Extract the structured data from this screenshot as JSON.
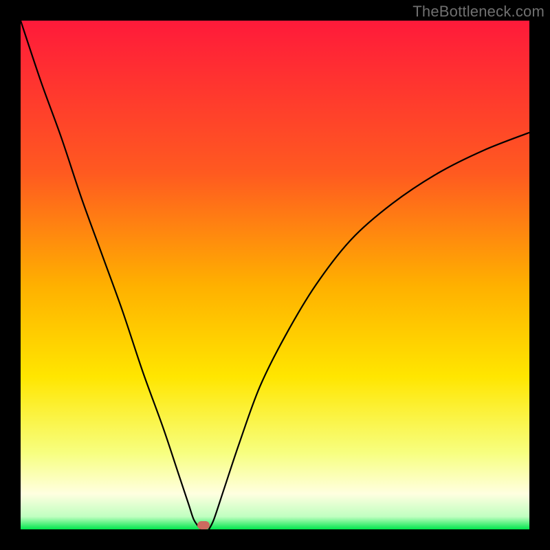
{
  "watermark": "TheBottleneck.com",
  "colors": {
    "top": "#ff1a3a",
    "upper_mid": "#ff8a00",
    "mid": "#ffe600",
    "lower_mid": "#f7ff66",
    "pale": "#ffffdd",
    "green": "#00e64d",
    "marker": "#cc6a5f",
    "curve": "#000000",
    "frame": "#000000"
  },
  "chart_data": {
    "type": "line",
    "title": "",
    "xlabel": "",
    "ylabel": "",
    "xlim": [
      0,
      100
    ],
    "ylim": [
      0,
      100
    ],
    "series": [
      {
        "name": "bottleneck-curve-left",
        "x": [
          0,
          4,
          8,
          12,
          16,
          20,
          24,
          28,
          31,
          33,
          34,
          35,
          35.5
        ],
        "y": [
          100,
          88,
          77,
          65,
          54,
          43,
          31,
          20,
          11,
          5,
          2,
          0.5,
          0
        ]
      },
      {
        "name": "bottleneck-curve-right",
        "x": [
          37,
          38,
          40,
          43,
          47,
          52,
          58,
          65,
          73,
          82,
          91,
          100
        ],
        "y": [
          0,
          2,
          8,
          17,
          28,
          38,
          48,
          57,
          64,
          70,
          74.5,
          78
        ]
      }
    ],
    "marker": {
      "x": 36,
      "y": 0.8
    },
    "gradient_bands": [
      {
        "pos": 0.0,
        "color": "#ff1a3a"
      },
      {
        "pos": 0.3,
        "color": "#ff5a20"
      },
      {
        "pos": 0.52,
        "color": "#ffb000"
      },
      {
        "pos": 0.7,
        "color": "#ffe600"
      },
      {
        "pos": 0.85,
        "color": "#f7ff80"
      },
      {
        "pos": 0.93,
        "color": "#ffffe0"
      },
      {
        "pos": 0.975,
        "color": "#c0ffc0"
      },
      {
        "pos": 1.0,
        "color": "#00e64d"
      }
    ]
  }
}
